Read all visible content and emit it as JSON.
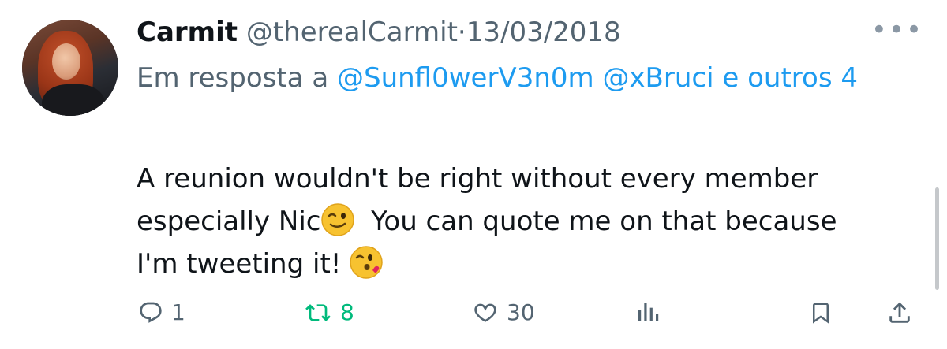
{
  "tweet": {
    "author_name": "Carmit",
    "author_handle": "@therealCarmit",
    "separator": "·",
    "date": "13/03/2018",
    "reply_prefix": "Em resposta a",
    "reply_mention_1": "@Sunfl0werV3n0m",
    "reply_mention_2": "@xBruci",
    "reply_others": "e outros 4",
    "text_line_1": "A reunion wouldn't be right without every member",
    "text_line_2a": "especially Nic",
    "text_line_2b": "You can quote me on that because",
    "text_line_3": "I'm tweeting it!",
    "more_label": "•••"
  },
  "actions": {
    "replies": "1",
    "retweets": "8",
    "likes": "30"
  },
  "colors": {
    "link": "#1d9bf0",
    "secondary": "#536471",
    "retweet": "#00ba7c"
  }
}
